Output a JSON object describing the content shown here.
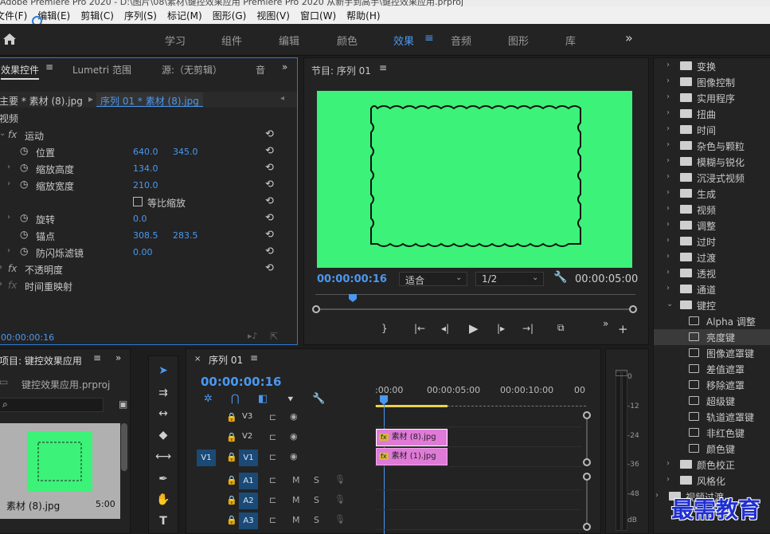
{
  "window": {
    "title": "Adobe Premiere Pro 2020 - D:\\图片\\08\\素材\\键控效果应用 Premiere Pro 2020 从新手到高手\\键控效果应用.prproj"
  },
  "menu": [
    "文件(F)",
    "编辑(E)",
    "剪辑(C)",
    "序列(S)",
    "标记(M)",
    "图形(G)",
    "视图(V)",
    "窗口(W)",
    "帮助(H)"
  ],
  "workspaces": [
    "学习",
    "组件",
    "编辑",
    "颜色",
    "效果",
    "音频",
    "图形",
    "库"
  ],
  "workspace_more": "»",
  "effect_controls": {
    "tabs": [
      "效果控件",
      "Lumetri 范围",
      "源:（无剪辑）",
      "音"
    ],
    "more": "»",
    "source_label": "主要 * 素材 (8).jpg",
    "seq_label": "序列 01 * 素材 (8).jpg",
    "section_video": "视频",
    "rows": [
      {
        "label": "运动",
        "v1": "",
        "v2": ""
      },
      {
        "label": "位置",
        "v1": "640.0",
        "v2": "345.0"
      },
      {
        "label": "缩放高度",
        "v1": "134.0",
        "v2": ""
      },
      {
        "label": "缩放宽度",
        "v1": "210.0",
        "v2": ""
      },
      {
        "label": "等比缩放",
        "v1": "",
        "v2": ""
      },
      {
        "label": "旋转",
        "v1": "0.0",
        "v2": ""
      },
      {
        "label": "锚点",
        "v1": "308.5",
        "v2": "283.5"
      },
      {
        "label": "防闪烁滤镜",
        "v1": "0.00",
        "v2": ""
      },
      {
        "label": "不透明度",
        "v1": "",
        "v2": ""
      },
      {
        "label": "时间重映射",
        "v1": "",
        "v2": ""
      }
    ],
    "timecode": "00:00:00:16"
  },
  "program": {
    "title": "节目: 序列 01",
    "timecode": "00:00:00:16",
    "fit": "适合",
    "quality": "1/2",
    "duration": "00:00:05:00",
    "bg_color": "#3cf278"
  },
  "project": {
    "title": "项目: 键控效果应用",
    "file": "键控效果应用.prproj",
    "clip_name": "素材 (8).jpg",
    "clip_duration": "5:00"
  },
  "timeline": {
    "title": "序列 01",
    "timecode": "00:00:00:16",
    "ruler": [
      ":00:00",
      "00:00:05:00",
      "00:00:10:00",
      "00"
    ],
    "tracks": [
      "V3",
      "V2",
      "V1",
      "A1",
      "A2",
      "A3"
    ],
    "source_patch": "V1",
    "clips": [
      "素材 (8).jpg",
      "素材 (1).jpg"
    ],
    "mute": "M",
    "solo": "S"
  },
  "meter": {
    "labels": [
      "0",
      "-12",
      "-24",
      "-36",
      "-48",
      "dB"
    ]
  },
  "effects_tree": {
    "items": [
      "变换",
      "图像控制",
      "实用程序",
      "扭曲",
      "时间",
      "杂色与颗粒",
      "模糊与锐化",
      "沉浸式视频",
      "生成",
      "视频",
      "调整",
      "过时",
      "过渡",
      "透视",
      "通道",
      "键控"
    ],
    "keying": [
      "Alpha 调整",
      "亮度键",
      "图像遮罩键",
      "差值遮罩",
      "移除遮罩",
      "超级键",
      "轨道遮罩键",
      "非红色键",
      "颜色键"
    ],
    "after": [
      "颜色校正",
      "风格化",
      "视频过渡"
    ]
  },
  "watermark": "最需教育"
}
